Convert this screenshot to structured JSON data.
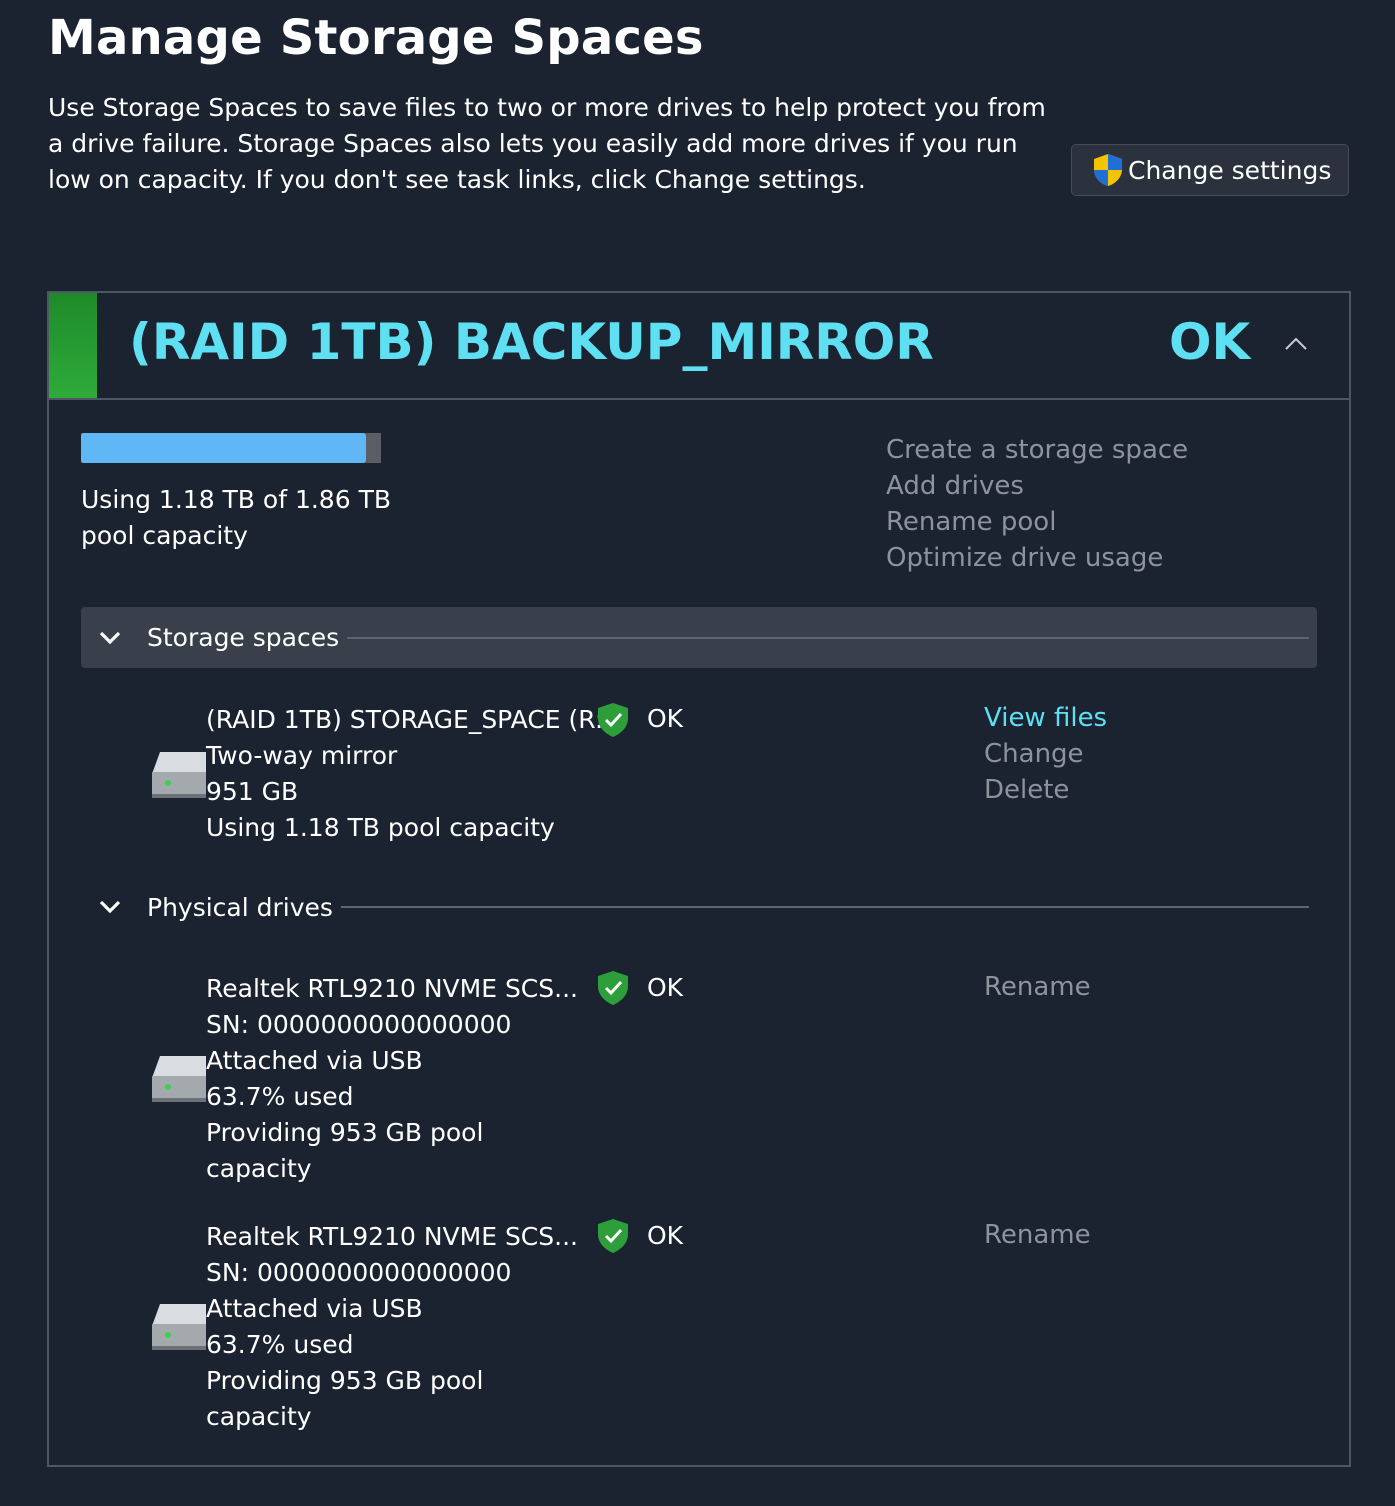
{
  "header": {
    "title": "Manage Storage Spaces",
    "description": "Use Storage Spaces to save files to two or more drives to help protect you from a drive failure. Storage Spaces also lets you easily add more drives if you run low on capacity. If you don't see task links, click Change settings.",
    "change_settings_label": "Change settings"
  },
  "pool": {
    "name": "(RAID 1TB) BACKUP_MIRROR",
    "status": "OK",
    "usage_fraction": 0.95,
    "capacity_line1": "Using 1.18 TB of 1.86 TB",
    "capacity_line2": "pool capacity",
    "tasks": [
      "Create a storage space",
      "Add drives",
      "Rename pool",
      "Optimize drive usage"
    ],
    "status_color": "#2fab3a",
    "accent_color": "#5fe0f2"
  },
  "storage_spaces": {
    "section_label": "Storage spaces",
    "items": [
      {
        "name": "(RAID 1TB) STORAGE_SPACE (R:)",
        "status": "OK",
        "type": "Two-way mirror",
        "size": "951 GB",
        "usage": "Using 1.18 TB pool capacity",
        "actions": [
          "View files",
          "Change",
          "Delete"
        ]
      }
    ]
  },
  "physical_drives": {
    "section_label": "Physical drives",
    "items": [
      {
        "name": "Realtek RTL9210 NVME SCS...",
        "status": "OK",
        "sn": "SN: 0000000000000000",
        "attach": "Attached via USB",
        "used": "63.7% used",
        "providing1": "Providing 953 GB pool",
        "providing2": "capacity",
        "action": "Rename"
      },
      {
        "name": "Realtek RTL9210 NVME SCS...",
        "status": "OK",
        "sn": "SN: 0000000000000000",
        "attach": "Attached via USB",
        "used": "63.7% used",
        "providing1": "Providing 953 GB pool",
        "providing2": "capacity",
        "action": "Rename"
      }
    ]
  }
}
